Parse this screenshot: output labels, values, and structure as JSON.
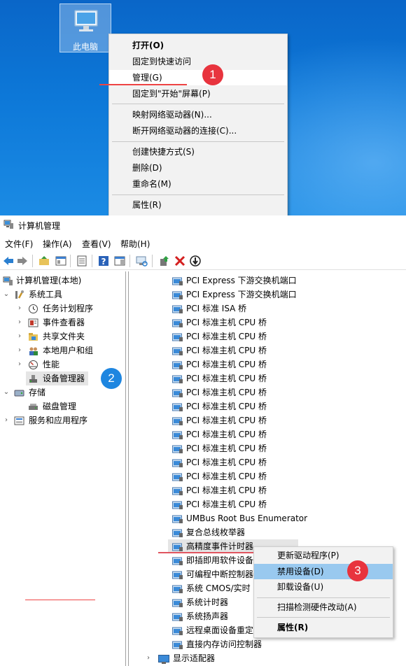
{
  "desktop": {
    "icon_label": "此电脑",
    "context_menu": {
      "items": [
        {
          "label": "打开(O)"
        },
        {
          "label": "固定到快速访问"
        },
        {
          "label": "管理(G)"
        },
        {
          "label": "固定到\"开始\"屏幕(P)"
        },
        {
          "label": "映射网络驱动器(N)..."
        },
        {
          "label": "断开网络驱动器的连接(C)..."
        },
        {
          "label": "创建快捷方式(S)"
        },
        {
          "label": "删除(D)"
        },
        {
          "label": "重命名(M)"
        },
        {
          "label": "属性(R)"
        }
      ]
    }
  },
  "steps": {
    "one": "1",
    "two": "2",
    "three": "3"
  },
  "window": {
    "title": "计算机管理",
    "menu": [
      "文件(F)",
      "操作(A)",
      "查看(V)",
      "帮助(H)"
    ],
    "tree": [
      {
        "label": "计算机管理(本地)"
      },
      {
        "label": "系统工具"
      },
      {
        "label": "任务计划程序"
      },
      {
        "label": "事件查看器"
      },
      {
        "label": "共享文件夹"
      },
      {
        "label": "本地用户和组"
      },
      {
        "label": "性能"
      },
      {
        "label": "设备管理器"
      },
      {
        "label": "存储"
      },
      {
        "label": "磁盘管理"
      },
      {
        "label": "服务和应用程序"
      }
    ],
    "devices": [
      "PCI Express 下游交换机端口",
      "PCI Express 下游交换机端口",
      "PCI 标准 ISA 桥",
      "PCI 标准主机 CPU 桥",
      "PCI 标准主机 CPU 桥",
      "PCI 标准主机 CPU 桥",
      "PCI 标准主机 CPU 桥",
      "PCI 标准主机 CPU 桥",
      "PCI 标准主机 CPU 桥",
      "PCI 标准主机 CPU 桥",
      "PCI 标准主机 CPU 桥",
      "PCI 标准主机 CPU 桥",
      "PCI 标准主机 CPU 桥",
      "PCI 标准主机 CPU 桥",
      "PCI 标准主机 CPU 桥",
      "PCI 标准主机 CPU 桥",
      "PCI 标准主机 CPU 桥",
      "UMBus Root Bus Enumerator",
      "复合总线枚举器",
      "高精度事件计时器",
      "即插即用软件设备",
      "可编程中断控制器",
      "系统 CMOS/实时",
      "系统计时器",
      "系统扬声器",
      "远程桌面设备重定",
      "直接内存访问控制器"
    ],
    "display_adapters": "显示适配器",
    "device_menu": [
      {
        "label": "更新驱动程序(P)"
      },
      {
        "label": "禁用设备(D)"
      },
      {
        "label": "卸载设备(U)"
      },
      {
        "label": "扫描检测硬件改动(A)"
      },
      {
        "label": "属性(R)"
      }
    ]
  }
}
